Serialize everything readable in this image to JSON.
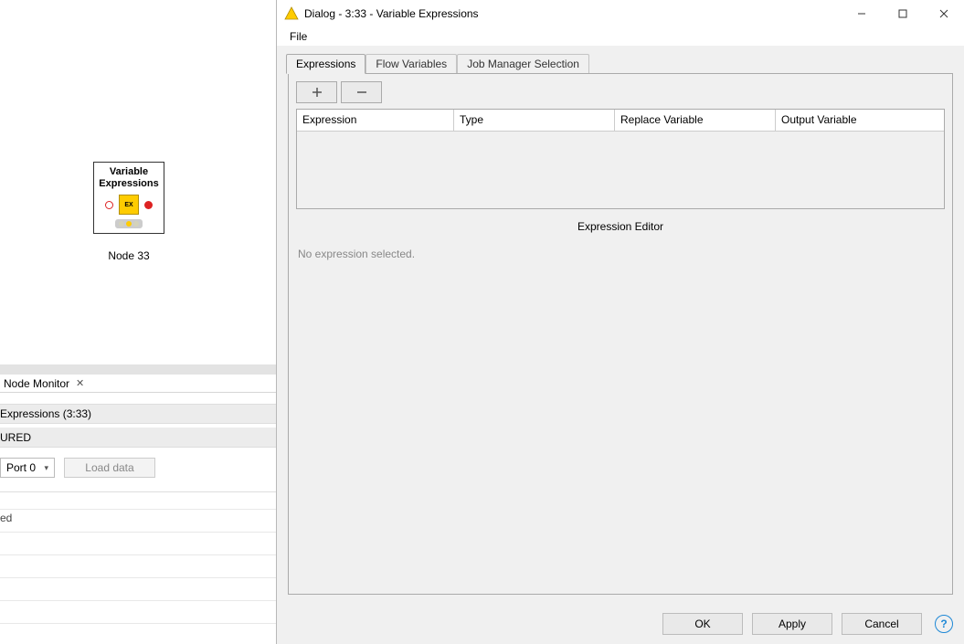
{
  "canvas": {
    "node_title_line1": "Variable",
    "node_title_line2": "Expressions",
    "node_chip": "EX",
    "node_label": "Node 33"
  },
  "monitor": {
    "tab_name": "Node Monitor",
    "expressions_row": "Expressions  (3:33)",
    "status_row": "URED",
    "port_select": "Port 0",
    "load_btn": "Load data",
    "table_cell": "ed"
  },
  "dialog": {
    "title": "Dialog - 3:33 - Variable Expressions",
    "menu_file": "File",
    "tabs": {
      "expressions": "Expressions",
      "flow_variables": "Flow Variables",
      "job_manager": "Job Manager Selection"
    },
    "table_headers": {
      "expression": "Expression",
      "type": "Type",
      "replace": "Replace Variable",
      "output": "Output Variable"
    },
    "editor_label": "Expression Editor",
    "editor_placeholder": "No expression selected.",
    "buttons": {
      "ok": "OK",
      "apply": "Apply",
      "cancel": "Cancel"
    }
  }
}
